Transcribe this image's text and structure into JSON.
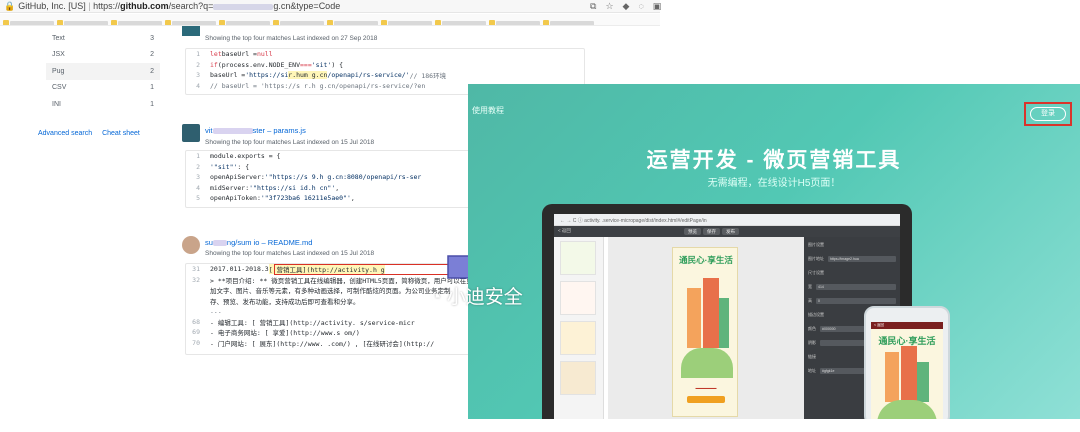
{
  "browser": {
    "site_label": "GitHub, Inc. [US]",
    "url_prefix": "https://",
    "url_host": "github.com",
    "url_path": "/search?q=",
    "url_suffix": "g.cn&type=Code"
  },
  "sidebar": {
    "languages": [
      {
        "name": "Text",
        "count": "3"
      },
      {
        "name": "JSX",
        "count": "2"
      },
      {
        "name": "Pug",
        "count": "2"
      },
      {
        "name": "CSV",
        "count": "1"
      },
      {
        "name": "INI",
        "count": "1"
      }
    ],
    "advanced_search": "Advanced search",
    "cheat_sheet": "Cheat sheet"
  },
  "results": [
    {
      "meta": "Showing the top four matches   Last indexed on 27 Sep 2018",
      "lines": [
        {
          "n": "1",
          "parts": [
            [
              "kw",
              "let "
            ],
            [
              "ct",
              "baseUrl = "
            ],
            [
              "kw",
              "null"
            ]
          ]
        },
        {
          "n": "2",
          "parts": [
            [
              "kw",
              "if "
            ],
            [
              "ct",
              "(process.env.NODE_ENV "
            ],
            [
              "kw",
              "=== "
            ],
            [
              "st",
              "'sit'"
            ],
            [
              "ct",
              ") {"
            ]
          ]
        },
        {
          "n": "3",
          "parts": [
            [
              "ct",
              "  baseUrl = "
            ],
            [
              "st",
              "'https://si"
            ],
            [
              "hl",
              "    r.hum         g.cn"
            ],
            [
              "st",
              "/openapi/rs-service/'"
            ],
            [
              "cm",
              " // 186环境"
            ]
          ]
        },
        {
          "n": "4",
          "parts": [
            [
              "cm",
              "  // baseUrl = 'https://s     r.h          g.cn/openapi/rs-service/?en"
            ]
          ]
        }
      ]
    },
    {
      "title_a": "vit",
      "title_b": "ster – params.js",
      "meta": "Showing the top four matches   Last indexed on 15 Jul 2018",
      "lines": [
        {
          "n": "1",
          "parts": [
            [
              "ct",
              "module.exports = {"
            ]
          ]
        },
        {
          "n": "2",
          "parts": [
            [
              "st",
              "  '\"sit\"'"
            ],
            [
              "ct",
              ": {"
            ]
          ]
        },
        {
          "n": "3",
          "parts": [
            [
              "ct",
              "    openApiServer: "
            ],
            [
              "st",
              "'\"https://s    9.h          g.cn:8080/openapi/rs-ser"
            ]
          ]
        },
        {
          "n": "4",
          "parts": [
            [
              "ct",
              "    midServer: "
            ],
            [
              "st",
              "'\"https://si      id.h          cn\"'"
            ],
            [
              "ct",
              ","
            ]
          ]
        },
        {
          "n": "5",
          "parts": [
            [
              "ct",
              "    openApiToken: "
            ],
            [
              "st",
              "'\"3f723ba6           16211e5ae0\"'"
            ],
            [
              "ct",
              ","
            ]
          ]
        }
      ]
    },
    {
      "title_a": "su",
      "title_b": "ng/sum            io – README.md",
      "meta": "Showing the top four matches   Last indexed on 15 Jul 2018",
      "lines": [
        {
          "n": "31",
          "parts": [
            [
              "ct",
              "2017.011-2018.3 "
            ],
            [
              "hl",
              "[   营销工具](http://activity.h          g"
            ]
          ]
        },
        {
          "n": "32",
          "parts": [
            [
              "ct",
              "> **项目介绍: ** 微页营销工具在线编辑器，创建HTML5页面，简称微页，用户可以在页面中"
            ]
          ]
        },
        {
          "n": "",
          "parts": [
            [
              "ct",
              "加文字、图片、音乐等元素，有多种动画选择，可制作酷炫的页面。为公司业务定制"
            ]
          ]
        },
        {
          "n": "",
          "parts": [
            [
              "ct",
              "存、预览、发布功能，支持成功后即可查看和分享。"
            ]
          ]
        },
        {
          "n": "",
          "parts": [
            [
              "cm",
              "..."
            ]
          ]
        },
        {
          "n": "68",
          "parts": [
            [
              "ct",
              "- 编辑工具: [   营销工具](http://activity.          s/service-micr"
            ]
          ]
        },
        {
          "n": "69",
          "parts": [
            [
              "ct",
              "- 电子商务网站: [    享爱](http://www.s       om/)"
            ]
          ]
        },
        {
          "n": "70",
          "parts": [
            [
              "ct",
              "- 门户网站: [    展东](http://www.      .com/) , [在线研讨会](http://"
            ]
          ]
        }
      ]
    }
  ],
  "app": {
    "tutorial": "使用教程",
    "login": "登录",
    "title": "运营开发 - 微页营销工具",
    "subtitle": "无需编程，在线设计H5页面！",
    "laptop_url": "activity.          .service-micropage/dist/index.html#/editPage/in",
    "back_label": "< 返回",
    "toolbar_buttons": [
      "预览",
      "保存",
      "发布"
    ],
    "poster_brand": "通民心·享生活",
    "right_panel": [
      {
        "label": "图片设置",
        "value": ""
      },
      {
        "label": "图片地址",
        "value": "https://image2.hua"
      },
      {
        "label": "尺寸设置",
        "value": ""
      },
      {
        "label": "宽",
        "value": "414"
      },
      {
        "label": "高",
        "value": "0"
      },
      {
        "label": "描边设置",
        "value": ""
      },
      {
        "label": "颜色",
        "value": "#000000"
      },
      {
        "label": "阴影",
        "value": ""
      },
      {
        "label": "链接",
        "value": ""
      },
      {
        "label": "地址",
        "value": "#gfgk1e"
      }
    ],
    "phone_bar": "< 返回",
    "phone_brand": "通民心·享生活"
  },
  "watermark": "小迪安全"
}
